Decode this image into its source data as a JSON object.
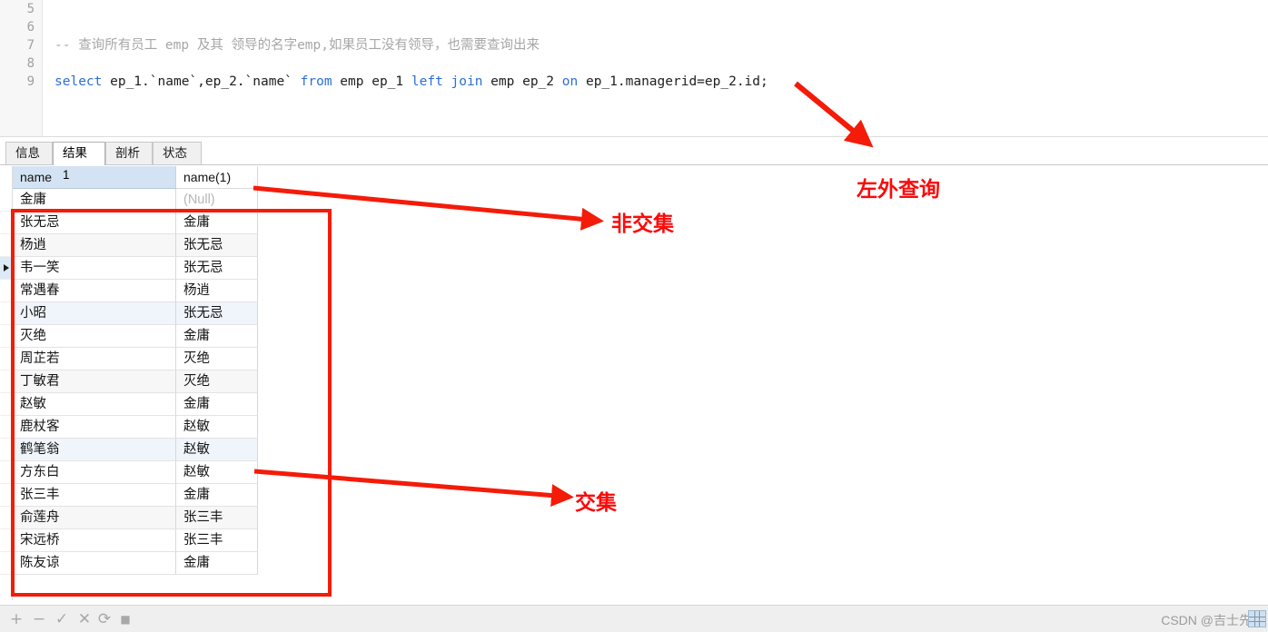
{
  "editor": {
    "line_numbers": [
      "5",
      "6",
      "7",
      "8",
      "9"
    ],
    "comment_line": "-- 查询所有员工 emp 及其 领导的名字emp,如果员工没有领导，也需要查询出来",
    "sql": {
      "kw_select": "select",
      "cols": " ep_1.`name`,ep_2.`name` ",
      "kw_from": "from",
      "mid": " emp ep_1 ",
      "kw_left": "left",
      "sp1": " ",
      "kw_join": "join",
      "mid2": " emp ep_2 ",
      "kw_on": "on",
      "tail": " ep_1.managerid=ep_2.id;"
    }
  },
  "tabs": [
    {
      "label": "信息",
      "active": false
    },
    {
      "label": "结果 1",
      "active": true
    },
    {
      "label": "剖析",
      "active": false
    },
    {
      "label": "状态",
      "active": false
    }
  ],
  "grid": {
    "columns": [
      "name",
      "name(1)"
    ],
    "null_text": "(Null)",
    "current_row_index": 3,
    "rows": [
      {
        "name": "金庸",
        "manager": "(Null)",
        "is_null": true,
        "stripe": "plain"
      },
      {
        "name": "张无忌",
        "manager": "金庸",
        "is_null": false,
        "stripe": "plain"
      },
      {
        "name": "杨逍",
        "manager": "张无忌",
        "is_null": false,
        "stripe": "alt"
      },
      {
        "name": "韦一笑",
        "manager": "张无忌",
        "is_null": false,
        "stripe": "plain"
      },
      {
        "name": "常遇春",
        "manager": "杨逍",
        "is_null": false,
        "stripe": "plain"
      },
      {
        "name": "小昭",
        "manager": "张无忌",
        "is_null": false,
        "stripe": "sel"
      },
      {
        "name": "灭绝",
        "manager": "金庸",
        "is_null": false,
        "stripe": "plain"
      },
      {
        "name": "周芷若",
        "manager": "灭绝",
        "is_null": false,
        "stripe": "plain"
      },
      {
        "name": "丁敏君",
        "manager": "灭绝",
        "is_null": false,
        "stripe": "alt"
      },
      {
        "name": "赵敏",
        "manager": "金庸",
        "is_null": false,
        "stripe": "plain"
      },
      {
        "name": "鹿杖客",
        "manager": "赵敏",
        "is_null": false,
        "stripe": "plain"
      },
      {
        "name": "鹤笔翁",
        "manager": "赵敏",
        "is_null": false,
        "stripe": "sel"
      },
      {
        "name": "方东白",
        "manager": "赵敏",
        "is_null": false,
        "stripe": "plain"
      },
      {
        "name": "张三丰",
        "manager": "金庸",
        "is_null": false,
        "stripe": "plain"
      },
      {
        "name": "俞莲舟",
        "manager": "张三丰",
        "is_null": false,
        "stripe": "alt"
      },
      {
        "name": "宋远桥",
        "manager": "张三丰",
        "is_null": false,
        "stripe": "plain"
      },
      {
        "name": "陈友谅",
        "manager": "金庸",
        "is_null": false,
        "stripe": "plain"
      }
    ]
  },
  "toolbar": {
    "add": "+",
    "remove": "−",
    "apply": "✓",
    "cancel": "✕",
    "refresh": "⟳",
    "stop": "■"
  },
  "watermark": {
    "text": "CSDN @吉士先生"
  },
  "annotations": {
    "left_outer_join": "左外查询",
    "non_intersection": "非交集",
    "intersection": "交集"
  },
  "colors": {
    "annotation_red": "#fb0a0a",
    "keyword_blue": "#2a6fd6",
    "comment_gray": "#a6a6a6",
    "header_blue": "#d3e3f3"
  }
}
